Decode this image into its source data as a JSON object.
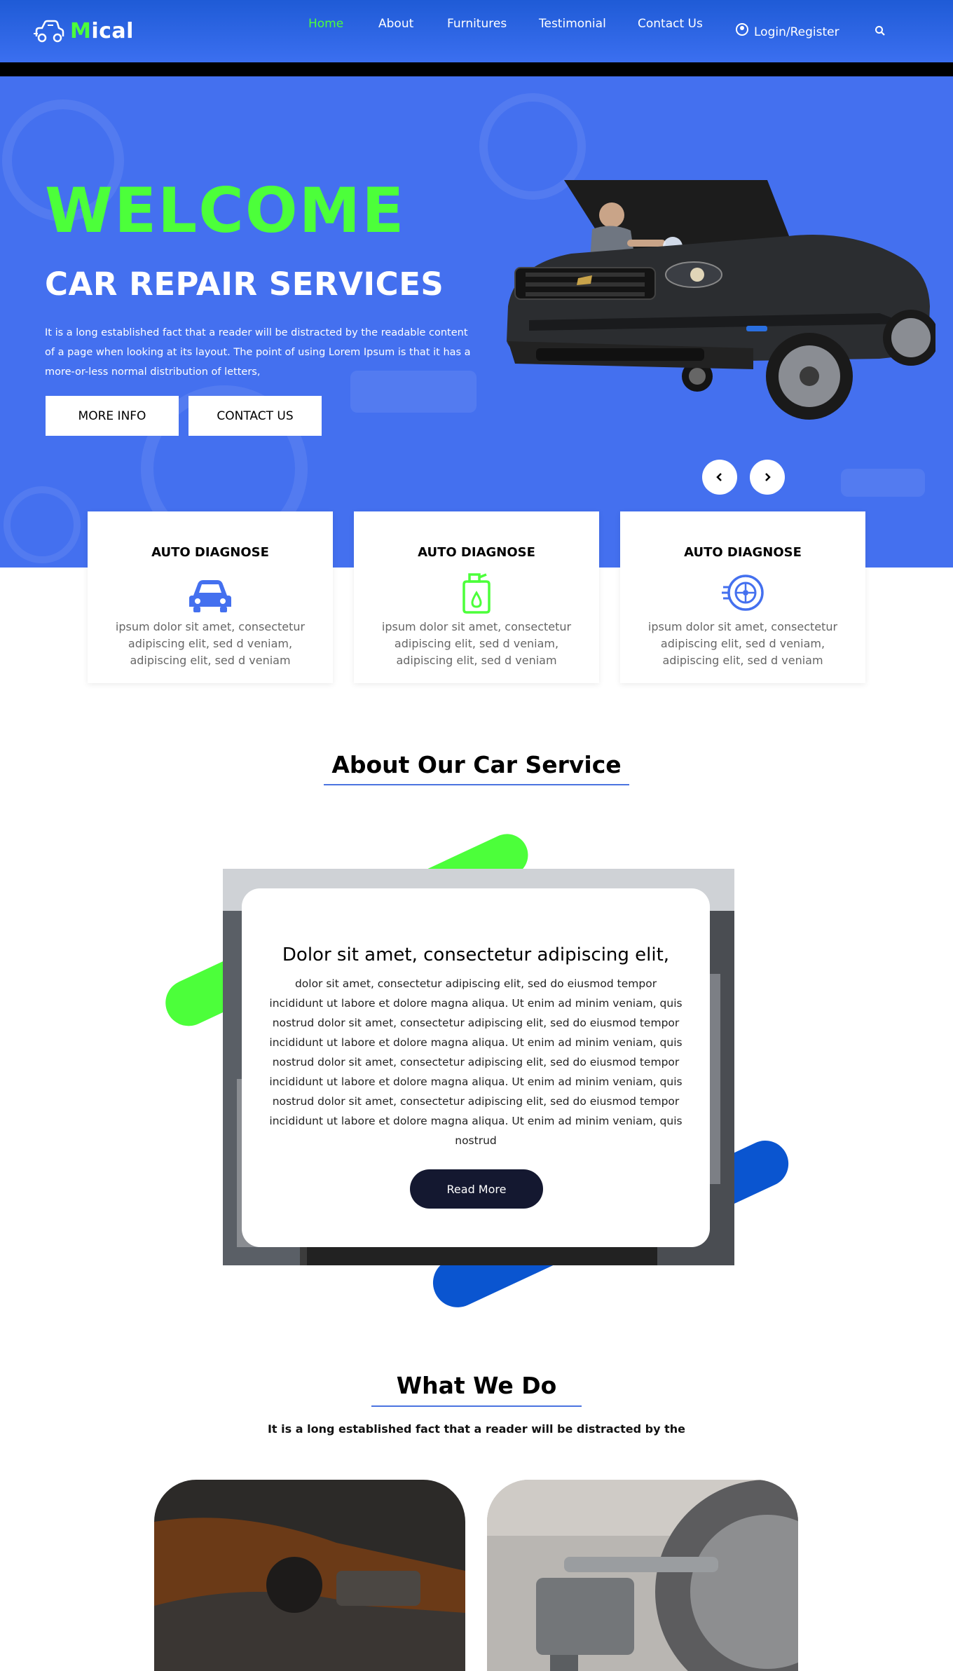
{
  "brand": {
    "name_first": "M",
    "name_rest": "ical"
  },
  "nav": {
    "home": "Home",
    "about": "About",
    "furnitures": "Furnitures",
    "testimonial": "Testimonial",
    "contact": "Contact Us",
    "login": "Login/Register"
  },
  "hero": {
    "welcome": "WELCOME",
    "subtitle": "CAR REPAIR SERVICES",
    "description": "It is a long established fact that a reader will be distracted by the readable content of a page when looking at its layout. The point of using Lorem Ipsum is that it has a more-or-less normal distribution of letters,",
    "btn_more": "MORE INFO",
    "btn_contact": "CONTACT US"
  },
  "services": [
    {
      "title": "AUTO DIAGNOSE",
      "icon": "car-icon",
      "text": "ipsum dolor sit amet, consectetur adipiscing elit, sed d veniam, adipiscing elit, sed d veniam"
    },
    {
      "title": "AUTO DIAGNOSE",
      "icon": "oil-can-icon",
      "text": "ipsum dolor sit amet, consectetur adipiscing elit, sed d veniam, adipiscing elit, sed d veniam"
    },
    {
      "title": "AUTO DIAGNOSE",
      "icon": "wheel-icon",
      "text": "ipsum dolor sit amet, consectetur adipiscing elit, sed d veniam, adipiscing elit, sed d veniam"
    }
  ],
  "about": {
    "section_title": "About Our Car Service",
    "heading": "Dolor sit amet, consectetur adipiscing elit,",
    "body": "dolor sit amet, consectetur adipiscing elit, sed do eiusmod tempor incididunt ut labore et dolore magna aliqua. Ut enim ad minim veniam, quis nostrud dolor sit amet, consectetur adipiscing elit, sed do eiusmod tempor incididunt ut labore et dolore magna aliqua. Ut enim ad minim veniam, quis nostrud dolor sit amet, consectetur adipiscing elit, sed do eiusmod tempor incididunt ut labore et dolore magna aliqua. Ut enim ad minim veniam, quis nostrud dolor sit amet, consectetur adipiscing elit, sed do eiusmod tempor incididunt ut labore et dolore magna aliqua. Ut enim ad minim veniam, quis nostrud",
    "read_more": "Read More"
  },
  "what_we_do": {
    "title": "What We Do",
    "subtitle": "It is a long established fact that a reader will be distracted by the"
  },
  "colors": {
    "primary": "#4470ef",
    "accent": "#4cff3a",
    "dark": "#141830",
    "blue_pill": "#0a55d0"
  }
}
